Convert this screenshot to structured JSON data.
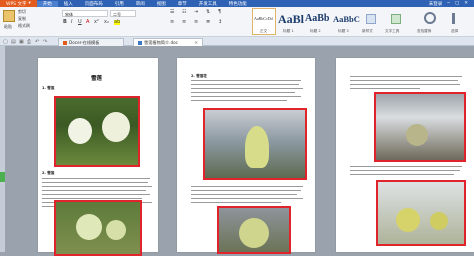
{
  "titlebar": {
    "app_label": "WPS 文字",
    "app_arrow": "▾",
    "menus": [
      "开始",
      "插入",
      "页面布局",
      "引用",
      "审阅",
      "视图",
      "章节",
      "开发工具",
      "特色功能"
    ],
    "active_menu": 0,
    "login_label": "未登录",
    "min": "─",
    "max": "□",
    "close": "✕"
  },
  "ribbon": {
    "cut_label": "剪切",
    "copy_label": "复制",
    "format_painter_label": "格式刷",
    "paste_label": "粘贴",
    "font_name": "宋体",
    "font_size": "二号",
    "styles": [
      {
        "sample": "AaBbCcDd",
        "label": "正文"
      },
      {
        "sample": "AaBl",
        "label": "标题 1"
      },
      {
        "sample": "AaBb",
        "label": "标题 2"
      },
      {
        "sample": "AaBbC",
        "label": "标题 3"
      }
    ],
    "new_style_label": "新样式",
    "text_tools_label": "文字工具",
    "find_replace_label": "查找替换",
    "select_label": "选择"
  },
  "tabs": [
    {
      "label": "Docer-在线模板"
    },
    {
      "label": "雪莲植物简介.doc"
    }
  ],
  "doc": {
    "page1_title": "雪莲",
    "page1_heading": "1. 雪莲",
    "page2_heading": "2. 雪莲花",
    "page1_caption": "2. 雪莲"
  },
  "colors": {
    "accent": "#2f62b4",
    "app": "#e35b1d",
    "highlight": "#e0242c"
  }
}
